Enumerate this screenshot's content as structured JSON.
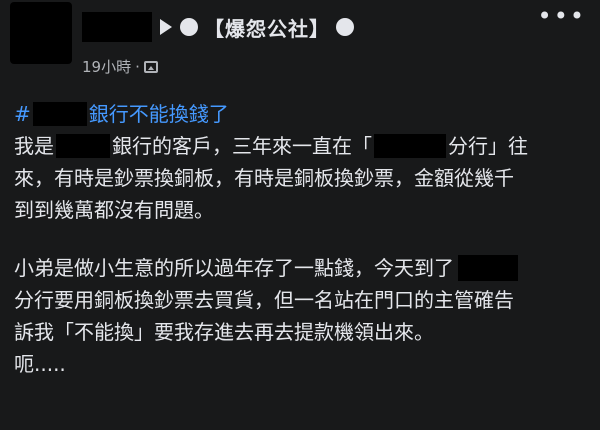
{
  "post": {
    "group_name": "【爆怨公社】",
    "timestamp": "19小時",
    "meta_separator": "·",
    "hashtag": {
      "prefix": "#",
      "suffix": "銀行不能換錢了"
    },
    "paragraph1": {
      "line1_a": "我是",
      "line1_b": "銀行的客戶，三年來一直在「",
      "line1_c": "分行」往",
      "line2": "來，有時是鈔票換銅板，有時是銅板換鈔票，金額從幾千",
      "line3": "到到幾萬都沒有問題。"
    },
    "paragraph2": {
      "line1": "小弟是做小生意的所以過年存了一點錢，今天到了",
      "line2": "分行要用銅板換鈔票去買貨，但一名站在門口的主管確告",
      "line3": "訴我「不能換」要我存進去再去提款機領出來。",
      "line4": "呃....."
    }
  },
  "icons": {
    "more": "more-options-icon",
    "arrow": "triangle-right-icon",
    "privacy": "photo-icon"
  },
  "colors": {
    "background": "#18191a",
    "text": "#e4e6eb",
    "secondary_text": "#b0b3b8",
    "hashtag": "#4599ff",
    "redaction": "#000000"
  }
}
